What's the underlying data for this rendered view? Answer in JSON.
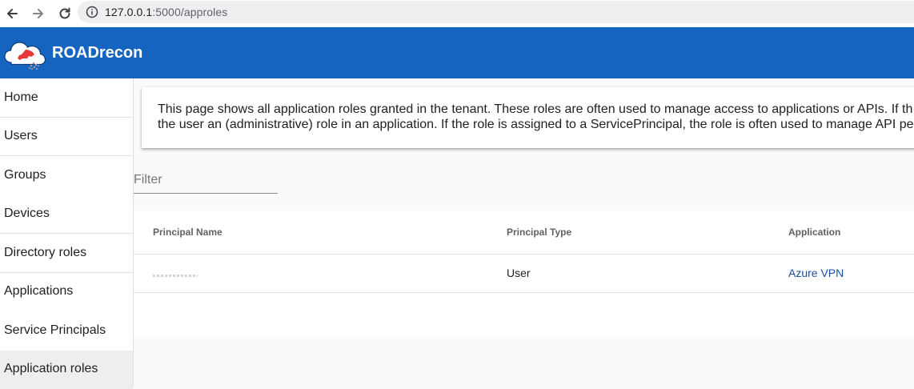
{
  "browser": {
    "url_host": "127.0.0.1",
    "url_path": ":5000/approles"
  },
  "header": {
    "title": "ROADrecon",
    "color": "#1565c0"
  },
  "sidebar": {
    "items": [
      {
        "label": "Home"
      },
      {
        "label": "Users"
      },
      {
        "label": "Groups"
      },
      {
        "label": "Devices"
      },
      {
        "label": "Directory roles"
      },
      {
        "label": "Applications"
      },
      {
        "label": "Service Principals"
      },
      {
        "label": "Application roles"
      }
    ],
    "active": "Application roles"
  },
  "main": {
    "info_line1": "This page shows all application roles granted in the tenant. These roles are often used to manage access to applications or APIs. If th",
    "info_line2": "the user an (administrative) role in an application. If the role is assigned to a ServicePrincipal, the role is often used to manage API per",
    "filter": {
      "placeholder": "Filter",
      "value": ""
    },
    "table": {
      "columns": [
        "Principal Name",
        "Principal Type",
        "Application"
      ],
      "rows": [
        {
          "principal_name": "",
          "principal_type": "User",
          "application": "Azure VPN"
        }
      ]
    }
  },
  "icons": {
    "back": "arrow-left-icon",
    "forward": "arrow-right-icon",
    "reload": "reload-icon",
    "info": "info-icon",
    "logo": "cloud-logo-icon"
  }
}
